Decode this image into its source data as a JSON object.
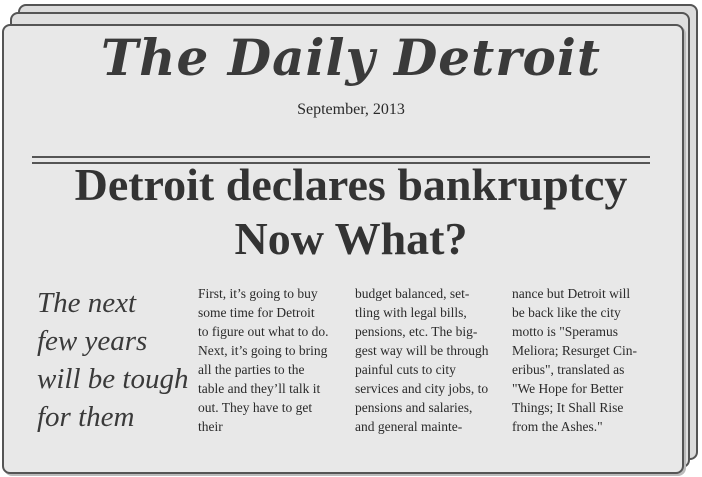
{
  "masthead": "The Daily Detroit",
  "date": "September, 2013",
  "headline": {
    "line1": "Detroit declares bankruptcy",
    "line2": "Now What?"
  },
  "pull_quote": "The next\nfew years\nwill be tough\nfor them",
  "columns": [
    "First, it’s going to buy\nsome time for Detroit\nto figure out what to do.\nNext, it’s going to bring\nall the parties to the\ntable and they’ll talk it\nout. They have to get\ntheir",
    "budget balanced, set-\ntling with legal bills,\npensions, etc. The big-\ngest way will be through\npainful cuts to city\nservices and city jobs, to\npensions and salaries,\nand general mainte-",
    "nance but Detroit will\nbe back like the city\nmotto is \"Speramus\nMeliora; Resurget Cin-\neribus\", translated as\n\"We Hope for Better\nThings; It Shall Rise\nfrom the Ashes.\""
  ]
}
